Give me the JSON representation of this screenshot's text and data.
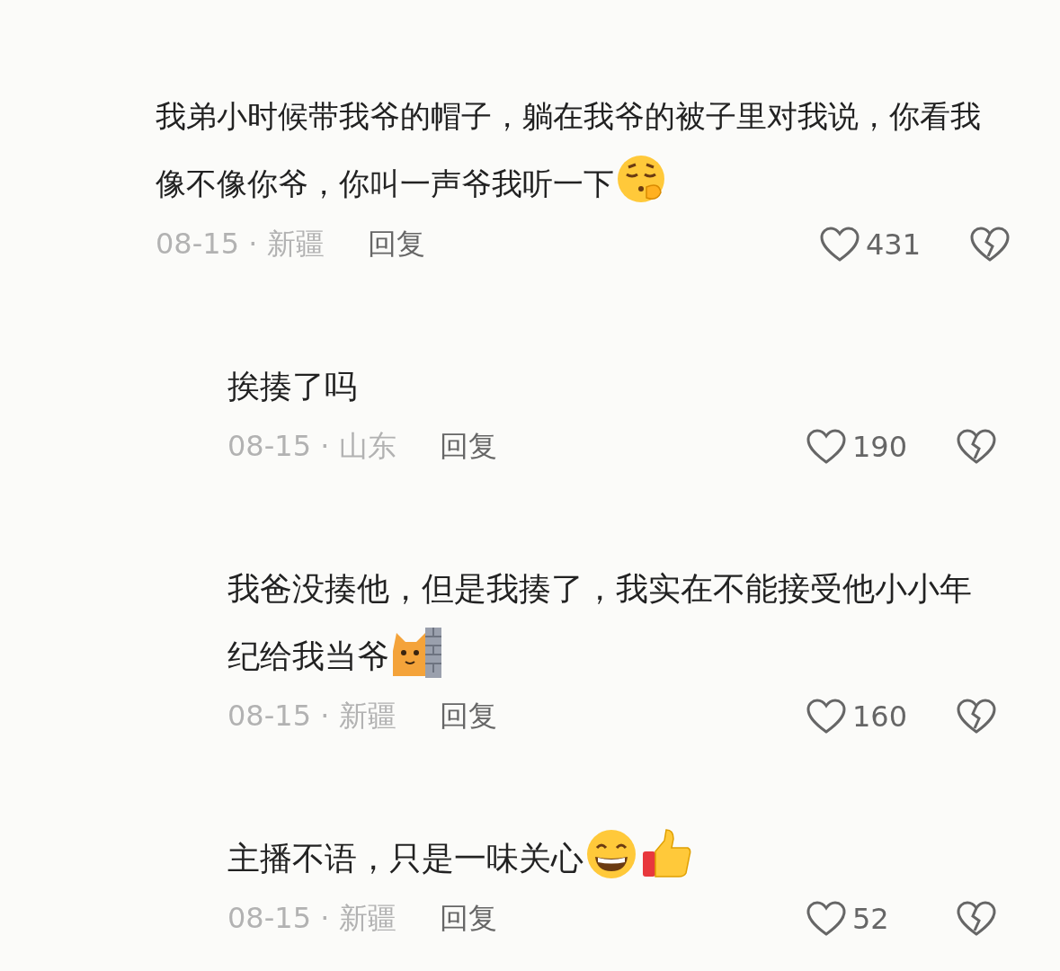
{
  "comments": [
    {
      "text": "我弟小时候带我爷的帽子，躺在我爷的被子里对我说，你看我像不像你爷，你叫一声爷我听一下",
      "emoji": [
        {
          "kind": "sleepy-face"
        }
      ],
      "date_location": "08-15 · 新疆",
      "reply_label": "回复",
      "likes": "431",
      "kind": "main"
    },
    {
      "text": "挨揍了吗",
      "date_location": "08-15 · 山东",
      "reply_label": "回复",
      "likes": "190",
      "kind": "reply"
    },
    {
      "text": "我爸没揍他，但是我揍了，我实在不能接受他小小年纪给我当爷",
      "emoji": [
        {
          "kind": "cat-wall"
        }
      ],
      "date_location": "08-15 · 新疆",
      "reply_label": "回复",
      "likes": "160",
      "kind": "reply"
    },
    {
      "text": "主播不语，只是一味关心",
      "emoji": [
        {
          "kind": "grin-face"
        },
        {
          "kind": "thumbs-up"
        }
      ],
      "date_location": "08-15 · 新疆",
      "reply_label": "回复",
      "likes": "52",
      "kind": "reply"
    }
  ]
}
